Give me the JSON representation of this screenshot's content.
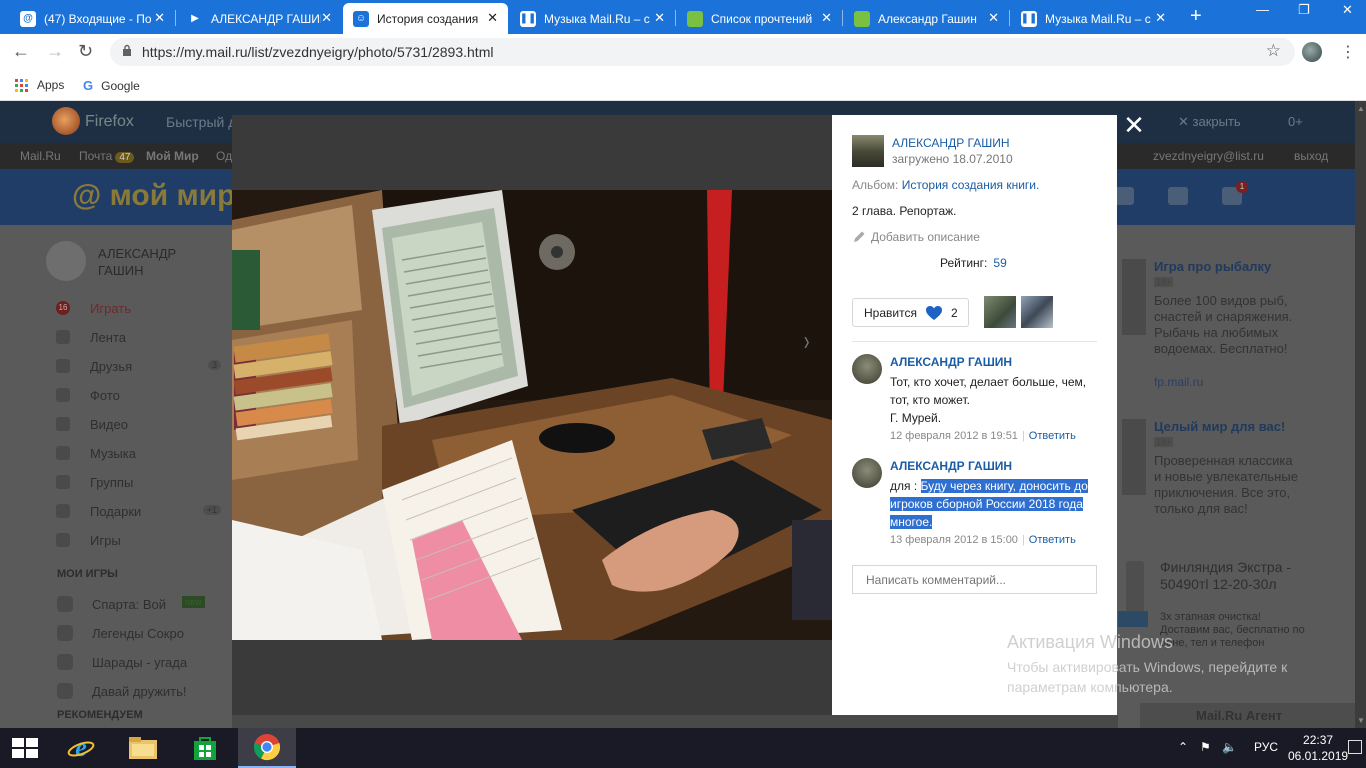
{
  "browser": {
    "tabs": [
      {
        "title": "(47) Входящие - По",
        "fav": "@",
        "fav_bg": "#ffffff",
        "fav_fg": "#1b73d9"
      },
      {
        "title": "АЛЕКСАНДР ГАШИН",
        "fav": "▶",
        "fav_bg": "#1b73d9",
        "fav_fg": "#ffffff"
      },
      {
        "title": "История создания",
        "fav": "☺",
        "fav_bg": "#1b73d9",
        "fav_fg": "#ffffff",
        "active": true
      },
      {
        "title": "Музыка Mail.Ru – с",
        "fav": "❚❚",
        "fav_bg": "#ffffff",
        "fav_fg": "#1b73d9"
      },
      {
        "title": "Список прочтений",
        "fav": "",
        "fav_bg": "#7ac142",
        "fav_fg": "#ffffff"
      },
      {
        "title": "Александр Гашин",
        "fav": "",
        "fav_bg": "#7ac142",
        "fav_fg": "#ffffff"
      },
      {
        "title": "Музыка Mail.Ru – с",
        "fav": "❚❚",
        "fav_bg": "#ffffff",
        "fav_fg": "#1b73d9"
      }
    ],
    "url": "https://my.mail.ru/list/zvezdnyeigry/photo/5731/2893.html",
    "bookmarks": {
      "apps": "Apps",
      "google": "Google"
    }
  },
  "background_page": {
    "firefox_label": "Firefox",
    "quick_label": "Быстрый д",
    "close_label": "закрыть",
    "counter": "0+",
    "topnav": {
      "mail": "Mail.Ru",
      "post": "Почта",
      "post_count": "47",
      "myworld": "Мой Мир",
      "od": "Од",
      "user_email": "zvezdnyeigry@list.ru",
      "logout": "выход"
    },
    "logo": "@ мой мир",
    "notif_count": "1",
    "profile_name": "АЛЕКСАНДР ГАШИН",
    "menu": [
      {
        "label": "Играть",
        "hot": true,
        "count": "16"
      },
      {
        "label": "Лента",
        "count": ""
      },
      {
        "label": "Друзья",
        "count": "3"
      },
      {
        "label": "Фото",
        "count": ""
      },
      {
        "label": "Видео",
        "count": ""
      },
      {
        "label": "Музыка",
        "count": ""
      },
      {
        "label": "Группы",
        "count": ""
      },
      {
        "label": "Подарки",
        "count": "+1"
      },
      {
        "label": "Игры",
        "count": ""
      }
    ],
    "my_games_title": "МОИ ИГРЫ",
    "games": [
      {
        "label": "Спарта: Вой",
        "new": "new"
      },
      {
        "label": "Легенды Сокро"
      },
      {
        "label": "Шарады - угада"
      },
      {
        "label": "Давай дружить!"
      }
    ],
    "recommended_title": "РЕКОМЕНДУЕМ",
    "promos": [
      {
        "title": "Игра про рыбалку",
        "age": "18+",
        "text": "Более 100 видов рыб, снастей и снаряжения. Рыбачь на любимых водоемах. Бесплатно!",
        "link": "fp.mail.ru"
      },
      {
        "title": "Целый мир для вас!",
        "age": "18+",
        "text": "Проверенная классика и новые увлекательные приключения. Все это, только для вас!",
        "link": ""
      }
    ],
    "product": {
      "title": "Финляндия Экстра - 50490тl 12-20-30л",
      "sub": "3х этапная очистка! Доставим вас, бесплатно по цене, тел и телефон"
    },
    "agent_label": "Mail.Ru Агент"
  },
  "photo_panel": {
    "author": "АЛЕКСАНДР ГАШИН",
    "uploaded": "загружено 18.07.2010",
    "album_label": "Альбом:",
    "album_name": "История создания книги.",
    "description": "2 глава. Репортаж.",
    "add_description": "Добавить описание",
    "rating_label": "Рейтинг:",
    "rating_value": "59",
    "like_label": "Нравится",
    "like_count": "2",
    "comments": [
      {
        "author": "АЛЕКСАНДР ГАШИН",
        "text": "Тот, кто хочет, делает больше, чем, тот, кто может.",
        "text2": "Г. Мурей.",
        "date": "12 февраля 2012 в 19:51",
        "reply": "Ответить"
      },
      {
        "author": "АЛЕКСАНДР ГАШИН",
        "prefix": "для : ",
        "text": "Буду через книгу, доносить до игроков сборной России 2018 года многое.",
        "date": "13 февраля 2012 в 15:00",
        "reply": "Ответить"
      }
    ],
    "comment_placeholder": "Написать комментарий..."
  },
  "watermark": {
    "line1": "Активация Windows",
    "line2": "Чтобы активировать Windows, перейдите к параметрам компьютера."
  },
  "taskbar": {
    "lang": "РУС",
    "time": "22:37",
    "date": "06.01.2019"
  }
}
